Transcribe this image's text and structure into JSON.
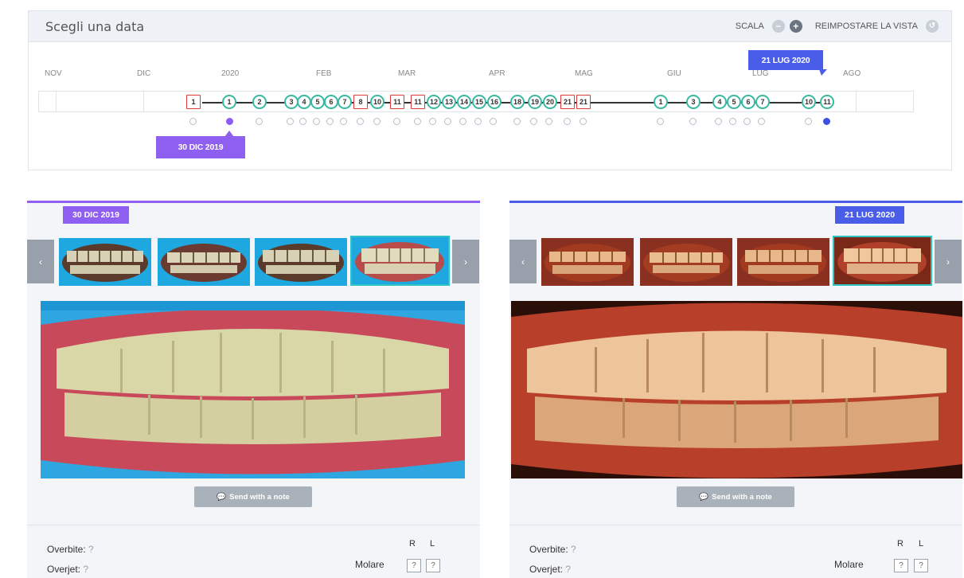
{
  "timeline": {
    "title": "Scegli una data",
    "scala_label": "SCALA",
    "zoom_out_symbol": "−",
    "zoom_in_symbol": "+",
    "reset_label": "REIMPOSTARE LA VISTA",
    "reset_symbol": "↺",
    "months": [
      "NOV",
      "DIC",
      "2020",
      "FEB",
      "MAR",
      "APR",
      "MAG",
      "GIU",
      "LUG",
      "AGO"
    ],
    "nodes": [
      "1",
      "1",
      "2",
      "3",
      "4",
      "5",
      "6",
      "7",
      "8",
      "10",
      "11",
      "11",
      "12",
      "13",
      "14",
      "15",
      "16",
      "18",
      "19",
      "20",
      "21",
      "21",
      "1",
      "3",
      "4",
      "5",
      "6",
      "7",
      "10",
      "11"
    ],
    "selected_start": "30 DIC 2019",
    "selected_end": "21 LUG 2020"
  },
  "left_panel": {
    "date": "30 DIC 2019",
    "prev_icon": "‹",
    "next_icon": "›",
    "send_label": "Send with a note",
    "overbite_label": "Overbite:",
    "overbite_value": "?",
    "overjet_label": "Overjet:",
    "overjet_value": "?",
    "r_label": "R",
    "l_label": "L",
    "molare_label": "Molare",
    "molare_r": "?",
    "molare_l": "?"
  },
  "right_panel": {
    "date": "21 LUG 2020",
    "prev_icon": "‹",
    "next_icon": "›",
    "send_label": "Send with a note",
    "overbite_label": "Overbite:",
    "overbite_value": "?",
    "overjet_label": "Overjet:",
    "overjet_value": "?",
    "r_label": "R",
    "l_label": "L",
    "molare_label": "Molare",
    "molare_r": "?",
    "molare_l": "?"
  },
  "colors": {
    "start_accent": "#8e5ff0",
    "end_accent": "#4a5de8",
    "scan_node": "#3bb8a0",
    "visit_node": "#e03a3a"
  }
}
